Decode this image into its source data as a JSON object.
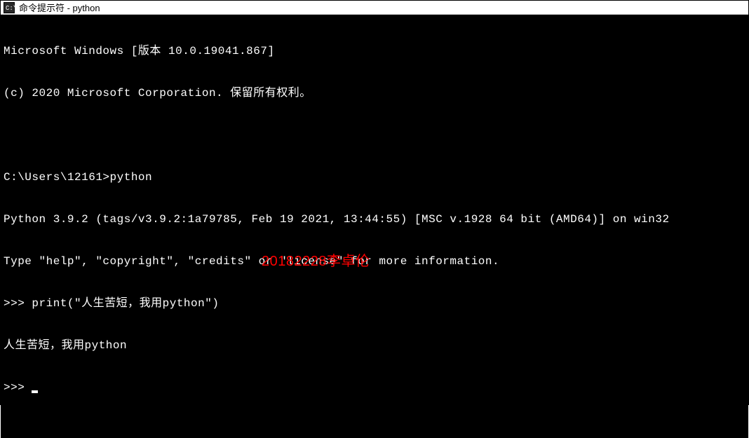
{
  "window": {
    "title": "命令提示符 - python"
  },
  "terminal": {
    "lines": [
      "Microsoft Windows [版本 10.0.19041.867]",
      "(c) 2020 Microsoft Corporation. 保留所有权利。",
      "",
      "C:\\Users\\12161>python",
      "Python 3.9.2 (tags/v3.9.2:1a79785, Feb 19 2021, 13:44:55) [MSC v.1928 64 bit (AMD64)] on win32",
      "Type \"help\", \"copyright\", \"credits\" or \"license\" for more information.",
      ">>> print(\"人生苦短，我用python\")",
      "人生苦短，我用python",
      ">>> "
    ]
  },
  "watermark": {
    "text": "20182228李卓伦"
  }
}
